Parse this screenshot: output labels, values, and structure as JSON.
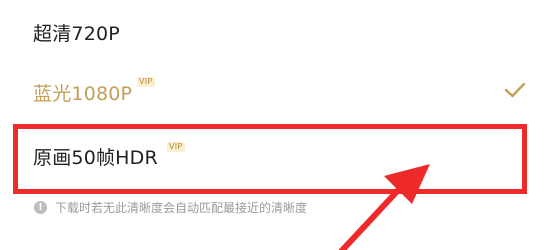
{
  "options": [
    {
      "label": "超清720P",
      "badge": "",
      "selected": false
    },
    {
      "label": "蓝光1080P",
      "badge": "VIP",
      "selected": true
    },
    {
      "label": "原画50帧HDR",
      "badge": "VIP",
      "selected": false
    }
  ],
  "hint": {
    "icon": "info-icon",
    "text": "下载时若无此清晰度会自动匹配最接近的清晰度"
  },
  "colors": {
    "selected_text": "#c2a05a",
    "highlight": "#ee2a2a",
    "badge_bg": "#fbefd0",
    "badge_text": "#b08a3a"
  }
}
